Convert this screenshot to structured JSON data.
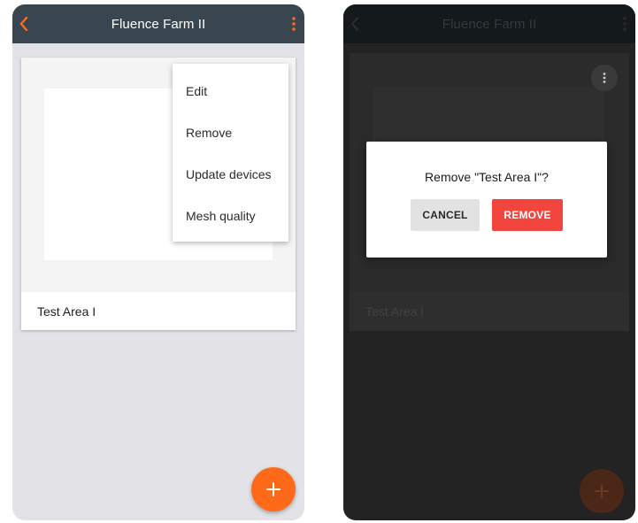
{
  "left_screen": {
    "appbar": {
      "title": "Fluence Farm II",
      "back_icon": "chevron-left-icon",
      "more_icon": "more-vertical-icon"
    },
    "card": {
      "name": "Test Area I"
    },
    "context_menu": {
      "items": [
        {
          "label": "Edit"
        },
        {
          "label": "Remove"
        },
        {
          "label": "Update devices"
        },
        {
          "label": "Mesh quality"
        }
      ]
    },
    "fab": {
      "icon": "plus-icon",
      "symbol": "+"
    }
  },
  "right_screen": {
    "appbar": {
      "title": "Fluence Farm II"
    },
    "card": {
      "name": "Test Area I"
    },
    "dialog": {
      "message": "Remove \"Test Area I\"?",
      "cancel_label": "CANCEL",
      "remove_label": "REMOVE"
    },
    "fab": {
      "icon": "plus-icon",
      "symbol": "+"
    }
  },
  "colors": {
    "accent_orange": "#ff6a1a",
    "appbar_bg": "#39464f",
    "remove_red": "#f2453d",
    "cancel_gray": "#e2e2e2",
    "screen_bg": "#e2e2e7",
    "overlay_bg": "#232323"
  }
}
